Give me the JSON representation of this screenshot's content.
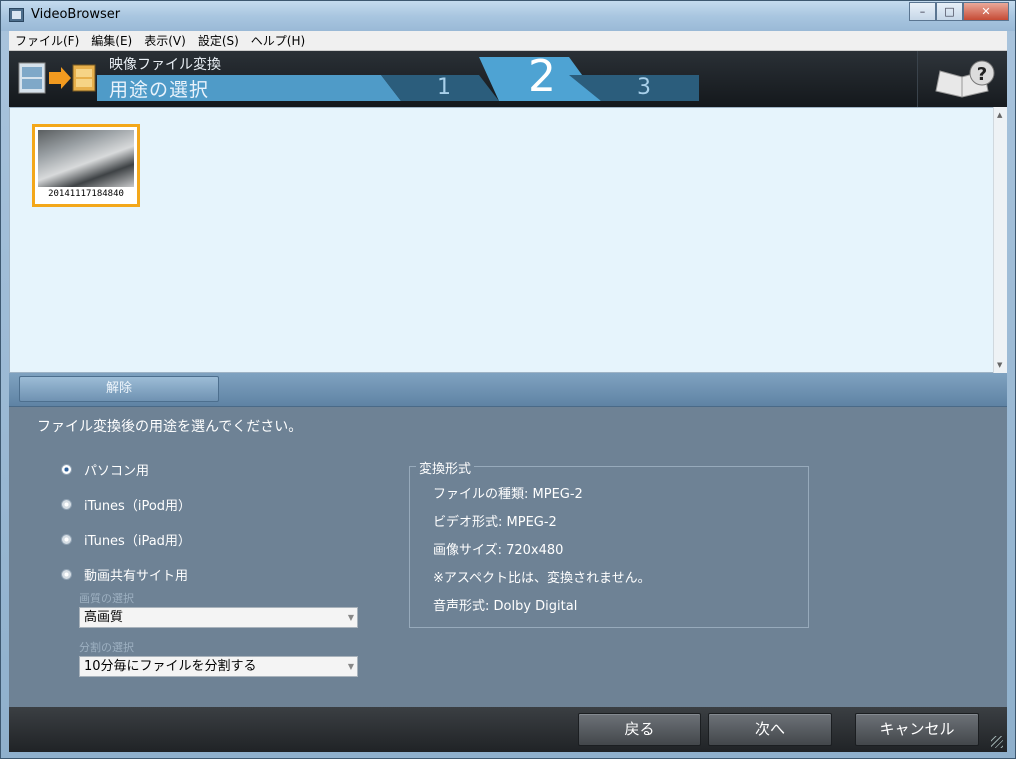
{
  "window": {
    "title": "VideoBrowser",
    "minimize": "–",
    "maximize": "□",
    "close": "✕"
  },
  "menu": [
    "ファイル(F)",
    "編集(E)",
    "表示(V)",
    "設定(S)",
    "ヘルプ(H)"
  ],
  "header": {
    "subtitle": "映像ファイル変換",
    "title": "用途の選択",
    "steps": [
      "1",
      "2",
      "3"
    ],
    "current_step": "2"
  },
  "thumbnail": {
    "label": "20141117184840"
  },
  "release_button": "解除",
  "instruction": "ファイル変換後の用途を選んでください。",
  "options": [
    {
      "label": "パソコン用",
      "checked": true
    },
    {
      "label": "iTunes（iPod用）",
      "checked": false
    },
    {
      "label": "iTunes（iPad用）",
      "checked": false
    },
    {
      "label": "動画共有サイト用",
      "checked": false
    }
  ],
  "quality": {
    "label": "画質の選択",
    "value": "高画質"
  },
  "split": {
    "label": "分割の選択",
    "value": "10分毎にファイルを分割する"
  },
  "conversion": {
    "legend": "変換形式",
    "lines": [
      "ファイルの種類: MPEG-2",
      "ビデオ形式: MPEG-2",
      "画像サイズ: 720x480",
      "※アスペクト比は、変換されません。",
      "音声形式: Dolby Digital"
    ]
  },
  "footer": {
    "back": "戻る",
    "next": "次へ",
    "cancel": "キャンセル"
  },
  "colors": {
    "highlight": "#f3a71a",
    "content_bg": "#e6f4fc",
    "panel_bg": "#6e8295"
  }
}
